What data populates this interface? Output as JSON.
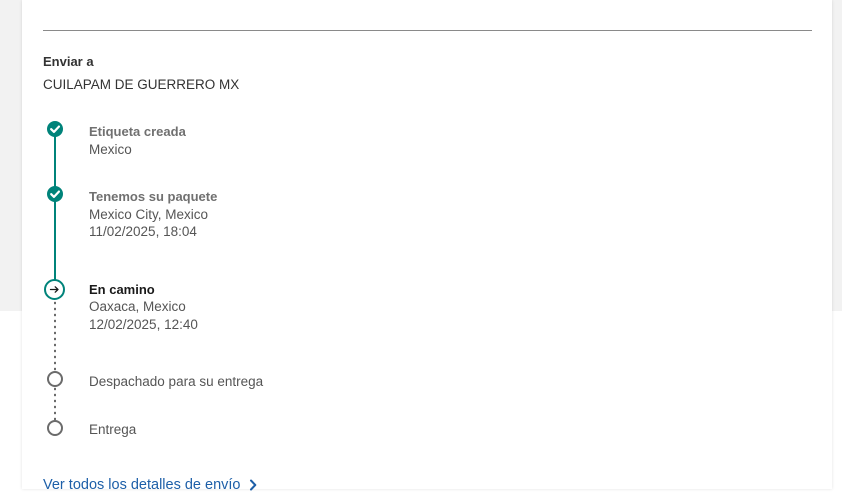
{
  "shipment": {
    "ship_to_label": "Enviar a",
    "destination": "CUILAPAM DE GUERRERO MX"
  },
  "steps": [
    {
      "title": "Etiqueta creada",
      "location": "Mexico",
      "status": "done"
    },
    {
      "title": "Tenemos su paquete",
      "location": "Mexico City, Mexico",
      "datetime": "11/02/2025, 18:04",
      "status": "done"
    },
    {
      "title": "En camino",
      "location": "Oaxaca, Mexico",
      "datetime": "12/02/2025, 12:40",
      "status": "current"
    },
    {
      "title": "Despachado para su entrega",
      "status": "pending"
    },
    {
      "title": "Entrega",
      "status": "pending"
    }
  ],
  "details_link": "Ver todos los detalles de envío",
  "icons": {
    "done": "check-icon",
    "current": "arrow-right-icon",
    "pending": "empty-circle-icon",
    "link": "chevron-right-icon"
  },
  "colors": {
    "accent": "#00837a",
    "link": "#1d5fa8",
    "text": "#333333",
    "muted": "#707070"
  }
}
